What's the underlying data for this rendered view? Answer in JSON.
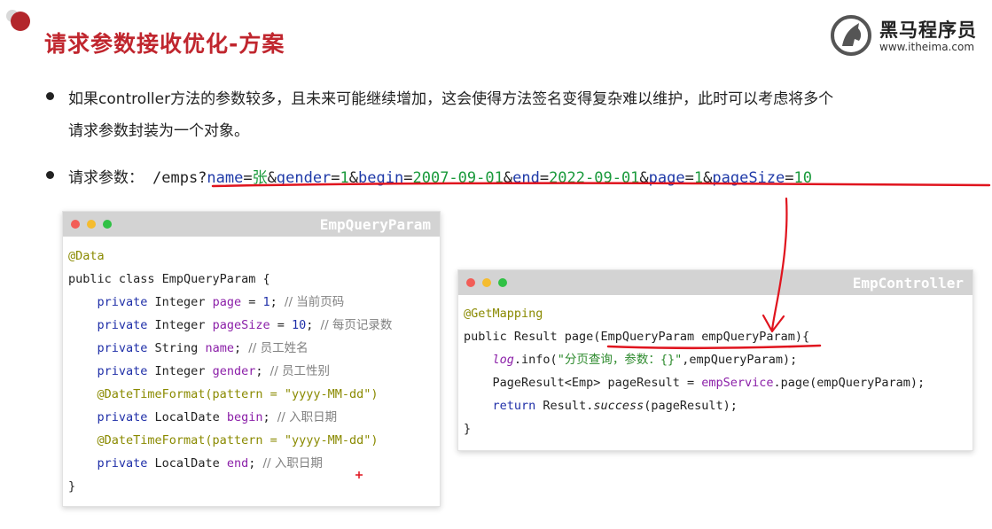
{
  "slide": {
    "title": "请求参数接收优化-方案",
    "logo": {
      "name": "黑马程序员",
      "url": "www.itheima.com"
    },
    "bullet1": {
      "line1": "如果controller方法的参数较多，且未来可能继续增加，这会使得方法签名变得复杂难以维护，此时可以考虑将多个",
      "line2": "请求参数封装为一个对象。"
    },
    "bullet2": {
      "label": "请求参数：",
      "path": "/emps?",
      "params": [
        {
          "key": "name",
          "value": "张"
        },
        {
          "key": "gender",
          "value": "1"
        },
        {
          "key": "begin",
          "value": "2007-09-01"
        },
        {
          "key": "end",
          "value": "2022-09-01"
        },
        {
          "key": "page",
          "value": "1"
        },
        {
          "key": "pageSize",
          "value": "10"
        }
      ]
    }
  },
  "card_param": {
    "title": "EmpQueryParam",
    "annotation": "@Data",
    "class_decl": "public class EmpQueryParam {",
    "fields": [
      {
        "annotation": "",
        "type": "Integer",
        "name": "page",
        "init": "1",
        "comment": "// 当前页码"
      },
      {
        "annotation": "",
        "type": "Integer",
        "name": "pageSize",
        "init": "10",
        "comment": "// 每页记录数"
      },
      {
        "annotation": "",
        "type": "String",
        "name": "name",
        "init": "",
        "comment": "// 员工姓名"
      },
      {
        "annotation": "",
        "type": "Integer",
        "name": "gender",
        "init": "",
        "comment": "// 员工性别"
      },
      {
        "annotation": "@DateTimeFormat(pattern = \"yyyy-MM-dd\")",
        "type": "LocalDate",
        "name": "begin",
        "init": "",
        "comment": "// 入职日期"
      },
      {
        "annotation": "@DateTimeFormat(pattern = \"yyyy-MM-dd\")",
        "type": "LocalDate",
        "name": "end",
        "init": "",
        "comment": "// 入职日期"
      }
    ],
    "close": "}"
  },
  "card_controller": {
    "title": "EmpController",
    "annotation": "@GetMapping",
    "method_prefix": "public Result page(",
    "method_param": "EmpQueryParam empQueryParam",
    "method_suffix": "){",
    "line_log_obj": "log",
    "line_log_rest": ".info(",
    "line_log_str": "\"分页查询，参数：{}\"",
    "line_log_end": ",empQueryParam);",
    "line_page_left": "PageResult<Emp> pageResult = ",
    "line_page_svc": "empService",
    "line_page_right": ".page(empQueryParam);",
    "line_return_kw": "return",
    "line_return_cls": " Result.",
    "line_return_fn": "success",
    "line_return_end": "(pageResult);",
    "close": "}"
  },
  "colors": {
    "title_red": "#c0262e",
    "annotation_pen": "#e0141e"
  }
}
